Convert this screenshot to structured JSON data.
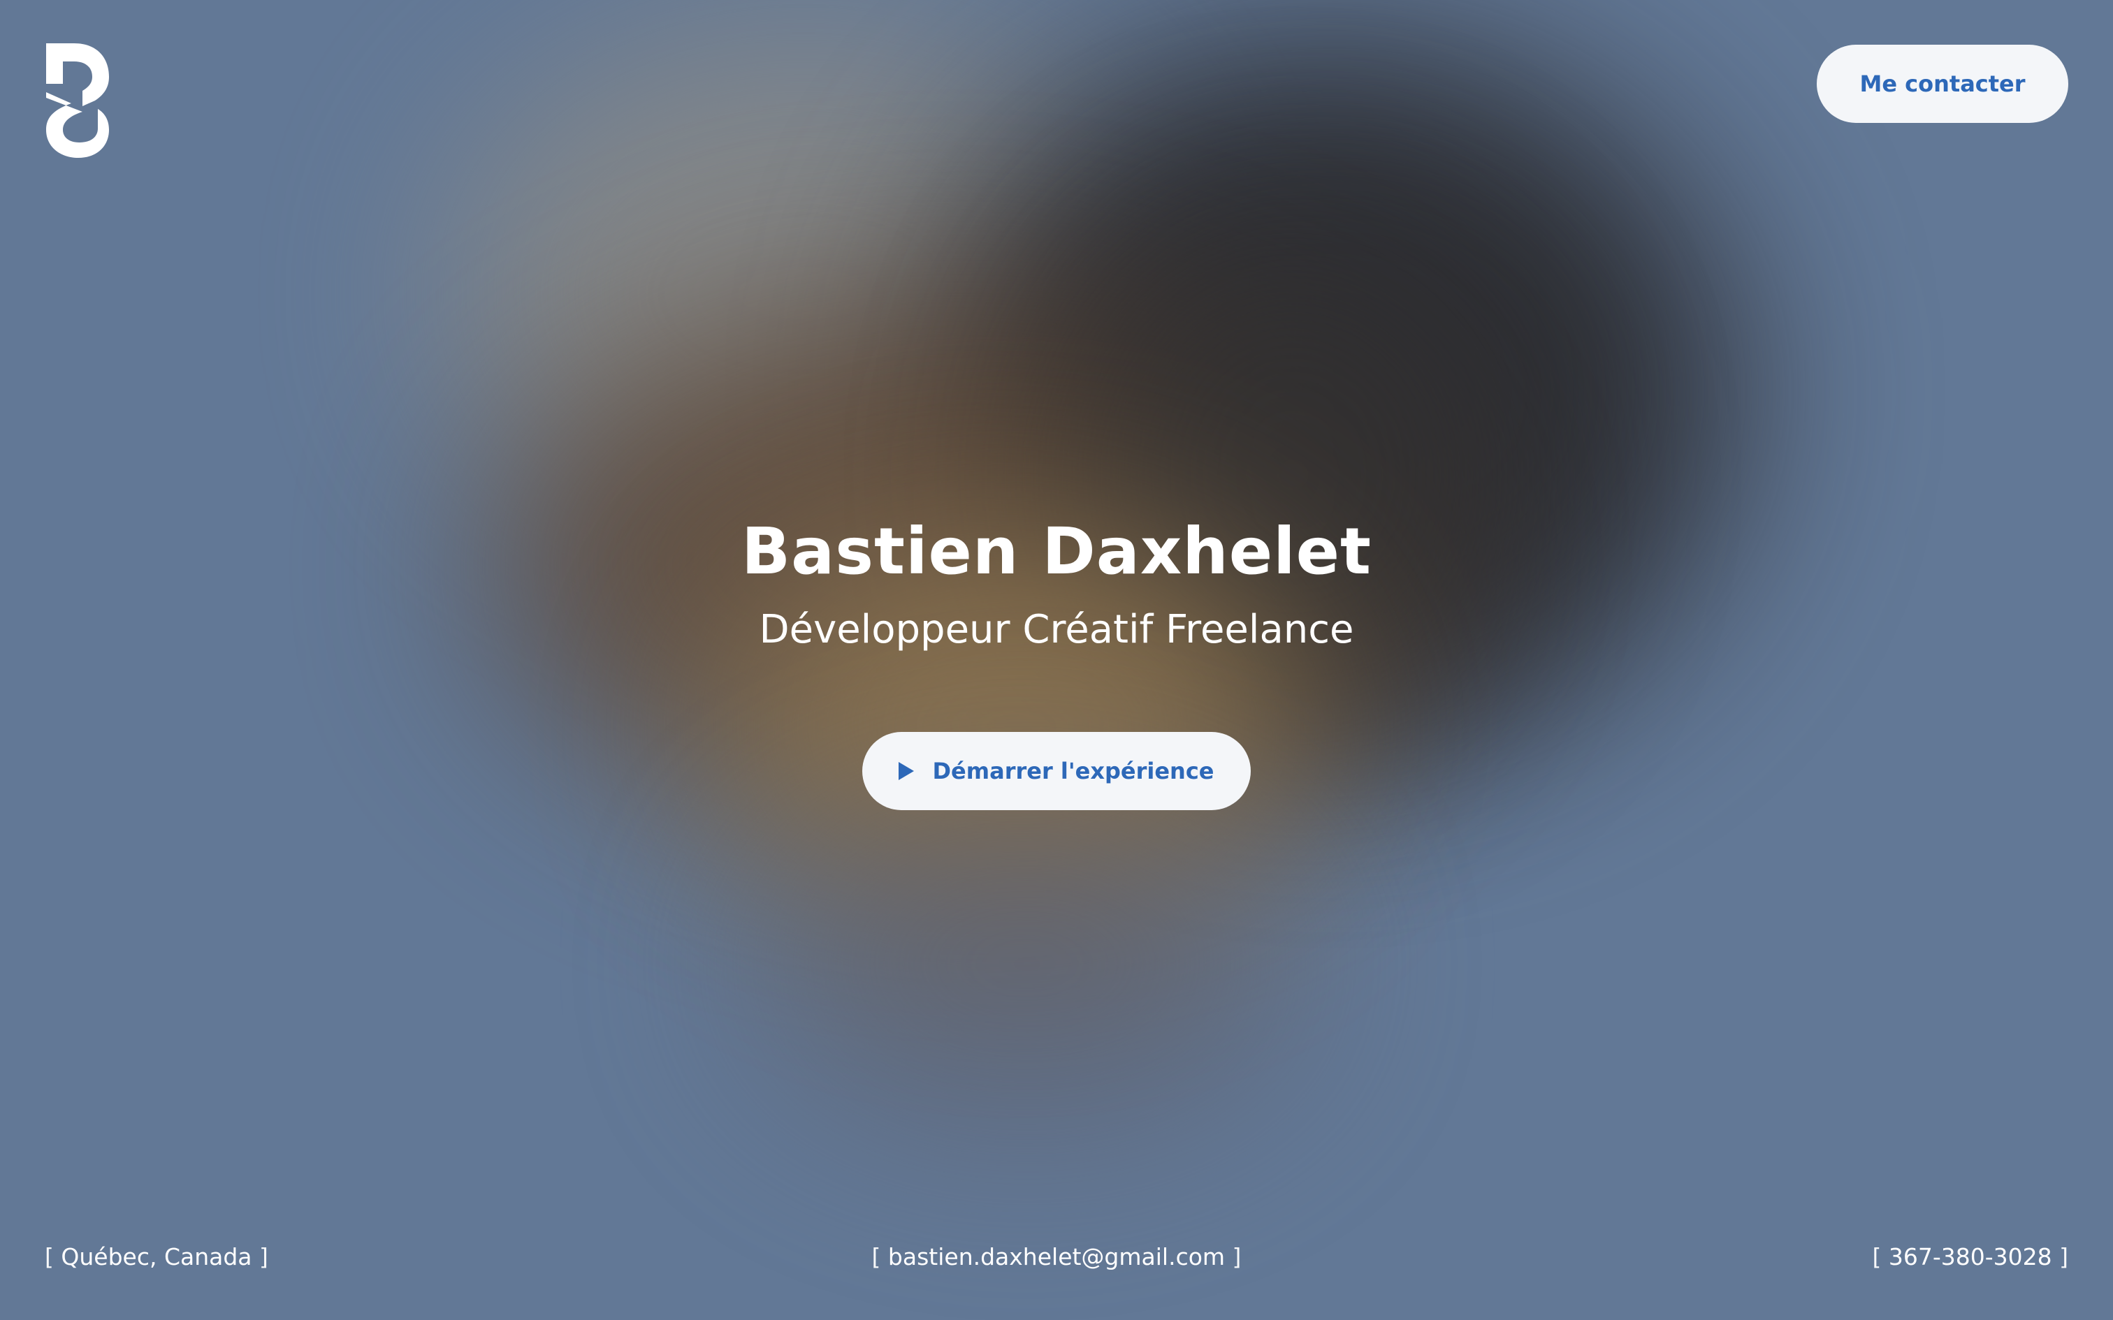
{
  "header": {
    "contact_label": "Me contacter"
  },
  "hero": {
    "title": "Bastien Daxhelet",
    "subtitle": "Développeur Créatif Freelance",
    "start_label": "Démarrer l'expérience"
  },
  "footer": {
    "location": "Québec, Canada",
    "email": "bastien.daxhelet@gmail.com",
    "phone": "367-380-3028"
  },
  "icons": {
    "logo": "logo-icon",
    "play": "play-icon"
  },
  "colors": {
    "background": "#627896",
    "accent": "#2d68b8",
    "button_bg": "#f4f6f9",
    "text": "#ffffff"
  }
}
